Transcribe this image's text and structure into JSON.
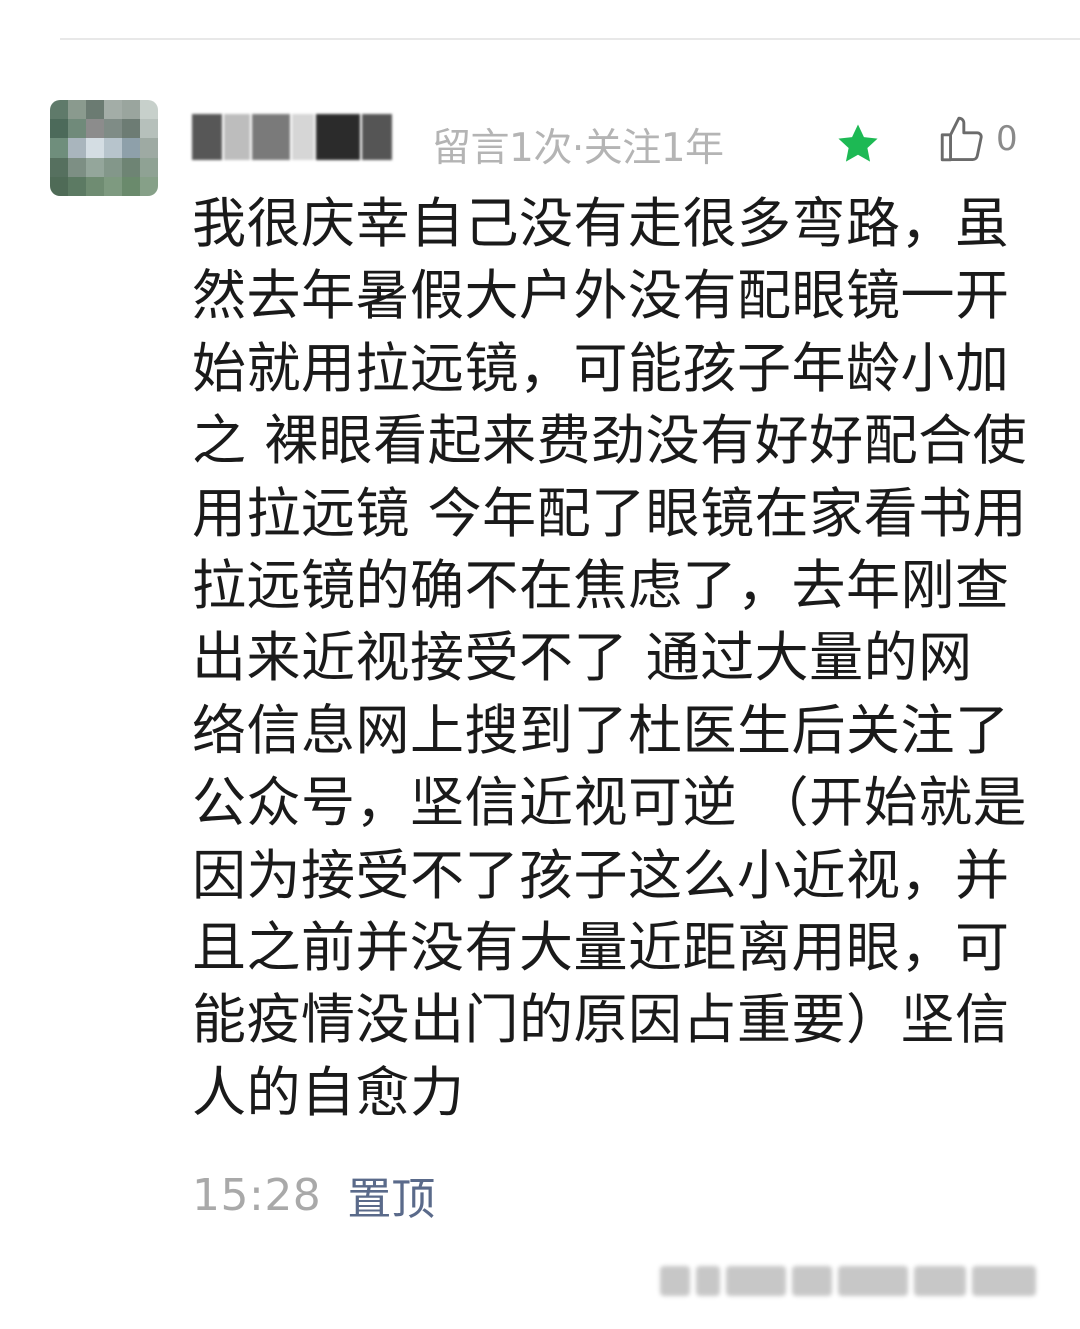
{
  "comment": {
    "meta": "留言1次·关注1年",
    "like_count": "0",
    "body_lines": [
      "我很庆幸自己没有走很多弯路，虽",
      "然去年暑假大户外没有配眼镜一开",
      "始就用拉远镜，可能孩子年龄小加",
      "之 裸眼看起来费劲没有好好配合使",
      "用拉远镜 今年配了眼镜在家看书用",
      "拉远镜的确不在焦虑了，去年刚查",
      "出来近视接受不了  通过大量的网",
      "络信息网上搜到了杜医生后关注了",
      "公众号，坚信近视可逆 （开始就是",
      "因为接受不了孩子这么小近视，并",
      "且之前并没有大量近距离用眼，可",
      "能疫情没出门的原因占重要）坚信",
      "人的自愈力"
    ],
    "time": "15:28",
    "pin_label": "置顶"
  },
  "colors": {
    "star": "#1db954",
    "meta_text": "#b4b4b4",
    "link": "#5a6a8a",
    "divider": "#e8e8e8"
  },
  "icons": {
    "star": "star-icon",
    "like": "thumbs-up-icon"
  }
}
